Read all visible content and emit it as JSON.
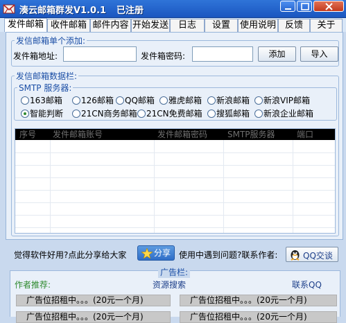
{
  "window": {
    "title": "湊云邮箱群发V1.0.1",
    "status": "已注册"
  },
  "tabs": [
    "发件邮箱",
    "收件邮箱",
    "邮件内容",
    "开始发送",
    "日志",
    "设置",
    "使用说明",
    "反馈",
    "关于"
  ],
  "add_single": {
    "group_title": "发信邮箱单个添加:",
    "address_label": "发件箱地址:",
    "address_value": "",
    "password_label": "发件箱密码:",
    "password_value": "",
    "add_button": "添加",
    "import_button": "导入"
  },
  "data_group": {
    "group_title": "发信邮箱数据栏:",
    "smtp_title": "SMTP 服务器:",
    "radios": [
      {
        "label": "163邮箱",
        "checked": false
      },
      {
        "label": "126邮箱",
        "checked": false
      },
      {
        "label": "QQ邮箱",
        "checked": false
      },
      {
        "label": "雅虎邮箱",
        "checked": false
      },
      {
        "label": "新浪邮箱",
        "checked": false
      },
      {
        "label": "新浪VIP邮箱",
        "checked": false
      },
      {
        "label": "智能判断",
        "checked": true
      },
      {
        "label": "21CN商务邮箱",
        "checked": false
      },
      {
        "label": "21CN免费邮箱",
        "checked": false
      },
      {
        "label": "搜狐邮箱",
        "checked": false
      },
      {
        "label": "新浪企业邮箱",
        "checked": false
      }
    ],
    "table_columns": [
      "序号",
      "发件邮箱账号",
      "发件邮箱密码",
      "SMTP服务器",
      "端口"
    ]
  },
  "share_row": {
    "prompt": "觉得软件好用?点此分享给大家",
    "share_button": "分享",
    "problem_prompt": "使用中遇到问题?联系作者:",
    "qq_button": "QQ交谈"
  },
  "ads": {
    "title": "广告栏:",
    "author_recommend": "作者推荐:",
    "resource_search": "资源搜索",
    "contact_qq": "联系QQ",
    "slots": [
      "广告位招租中。。。(20元一个月)",
      "广告位招租中。。。(20元一个月)",
      "广告位招租中。。。(20元一个月)",
      "广告位招租中。。。(20元一个月)"
    ]
  },
  "colors": {
    "titlebar": "#1f5fc8",
    "accent_blue": "#1c4fa6",
    "green_text": "#2f8a2f",
    "table_header": "#000000"
  }
}
